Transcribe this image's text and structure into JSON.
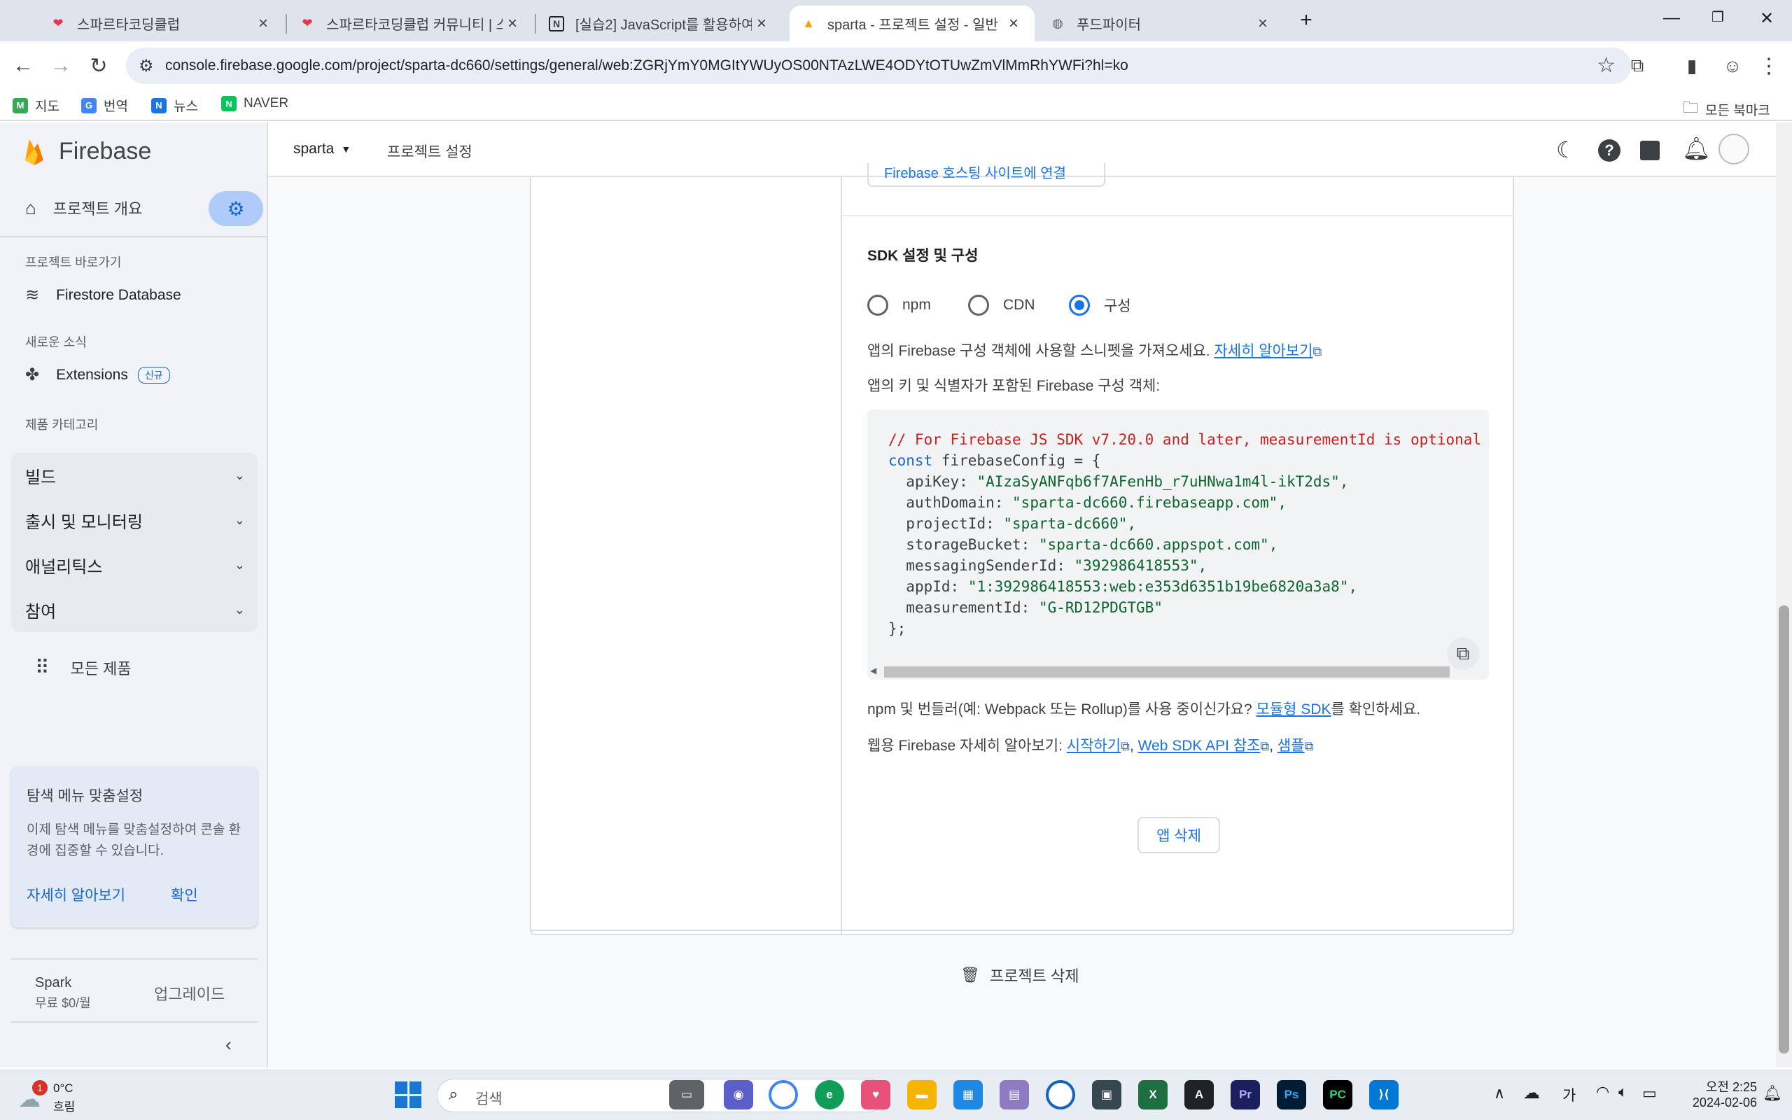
{
  "browser": {
    "tabs": [
      {
        "label": "스파르타코딩클럽",
        "active": false
      },
      {
        "label": "스파르타코딩클럽 커뮤니티 | 스",
        "active": false
      },
      {
        "label": "[실습2] JavaScript를 활용하여",
        "active": false
      },
      {
        "label": "sparta - 프로젝트 설정 - 일반",
        "active": true
      },
      {
        "label": "푸드파이터",
        "active": false
      }
    ],
    "url": "console.firebase.google.com/project/sparta-dc660/settings/general/web:ZGRjYmY0MGItYWUyOS00NTAzLWE4ODYtOTUwZmVlMmRhYWFi?hl=ko",
    "bookmarks": [
      "지도",
      "번역",
      "뉴스",
      "NAVER"
    ],
    "all_bookmarks": "모든 북마크"
  },
  "sidebar": {
    "brand": "Firebase",
    "overview": "프로젝트 개요",
    "shortcuts_label": "프로젝트 바로가기",
    "firestore": "Firestore Database",
    "news_label": "새로운 소식",
    "extensions": "Extensions",
    "new_badge": "신규",
    "category_label": "제품 카테고리",
    "groups": [
      "빌드",
      "출시 및 모니터링",
      "애널리틱스",
      "참여"
    ],
    "all_products": "모든 제품",
    "promo_title": "탐색 메뉴 맞춤설정",
    "promo_body": "이제 탐색 메뉴를 맞춤설정하여 콘솔 환경에 집중할 수 있습니다.",
    "promo_learn": "자세히 알아보기",
    "promo_ok": "확인",
    "plan_name": "Spark",
    "plan_price": "무료 $0/월",
    "upgrade": "업그레이드"
  },
  "topbar": {
    "project": "sparta",
    "page": "프로젝트 설정"
  },
  "content": {
    "partial_button": "Firebase 호스팅 사이트에 연결",
    "sdk_title": "SDK 설정 및 구성",
    "radio_options": [
      "npm",
      "CDN",
      "구성"
    ],
    "selected_option": "구성",
    "desc1": "앱의 Firebase 구성 객체에 사용할 스니펫을 가져오세요.",
    "desc1_link": "자세히 알아보기",
    "desc2": "앱의 키 및 식별자가 포함된 Firebase 구성 객체:",
    "code_comment": "// For Firebase JS SDK v7.20.0 and later, measurementId is optional",
    "code_const": "const",
    "code_decl": " firebaseConfig = {",
    "config": [
      {
        "key": "apiKey",
        "value": "\"AIzaSyANFqb6f7AFenHb_r7uHNwa1m4l-ikT2ds\","
      },
      {
        "key": "authDomain",
        "value": "\"sparta-dc660.firebaseapp.com\","
      },
      {
        "key": "projectId",
        "value": "\"sparta-dc660\","
      },
      {
        "key": "storageBucket",
        "value": "\"sparta-dc660.appspot.com\","
      },
      {
        "key": "messagingSenderId",
        "value": "\"392986418553\","
      },
      {
        "key": "appId",
        "value": "\"1:392986418553:web:e353d6351b19be6820a3a8\","
      },
      {
        "key": "measurementId",
        "value": "\"G-RD12PDGTGB\""
      }
    ],
    "code_close": "};",
    "npm_text_pre": "npm 및 번들러(예: Webpack 또는 Rollup)를 사용 중이신가요? ",
    "npm_link": "모듈형 SDK",
    "npm_text_post": "를 확인하세요.",
    "web_text": "웹용 Firebase 자세히 알아보기: ",
    "web_links": [
      "시작하기",
      "Web SDK API 참조",
      "샘플"
    ],
    "delete_app": "앱 삭제",
    "delete_project": "프로젝트 삭제"
  },
  "taskbar": {
    "weather_temp": "0°C",
    "weather_desc": "흐림",
    "weather_badge": "1",
    "search": "검색",
    "time": "오전 2:25",
    "date": "2024-02-06",
    "ime": "가"
  },
  "colors": {
    "accent": "#1a73e8",
    "code_comment": "#c5221f",
    "firebase_orange": "#ffa000"
  }
}
